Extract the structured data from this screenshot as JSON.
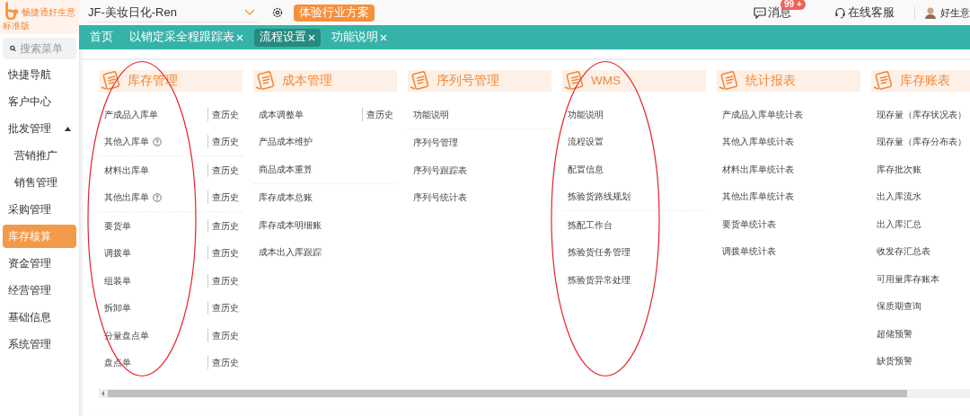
{
  "logo": {
    "brand": "畅捷通好生意",
    "edition": "标准版"
  },
  "header": {
    "account": "JF-美妆日化-Ren",
    "promo": "体验行业方案",
    "messages": {
      "label": "消息",
      "badge": "99 +"
    },
    "support": "在线客服",
    "user": "好生意"
  },
  "tabs": [
    {
      "label": "首页",
      "closable": false,
      "selected": false
    },
    {
      "label": "以销定采全程跟踪表",
      "closable": true,
      "selected": false
    },
    {
      "label": "流程设置",
      "closable": true,
      "selected": true
    },
    {
      "label": "功能说明",
      "closable": true,
      "selected": false
    }
  ],
  "sidebar": {
    "search_placeholder": "搜索菜单",
    "items": [
      {
        "label": "快捷导航",
        "selected": false
      },
      {
        "label": "客户中心",
        "selected": false
      },
      {
        "label": "批发管理",
        "selected": false,
        "expanded": true,
        "children": [
          {
            "label": "营销推广",
            "selected": false
          },
          {
            "label": "销售管理",
            "selected": false
          }
        ]
      },
      {
        "label": "采购管理",
        "selected": false
      },
      {
        "label": "库存核算",
        "selected": true
      },
      {
        "label": "资金管理",
        "selected": false
      },
      {
        "label": "经营管理",
        "selected": false
      },
      {
        "label": "基础信息",
        "selected": false
      },
      {
        "label": "系统管理",
        "selected": false
      }
    ]
  },
  "columns": [
    {
      "title": "库存管理",
      "circled": true,
      "groups": [
        [
          {
            "label": "产成品入库单",
            "help": false,
            "history": "查历史"
          },
          {
            "label": "其他入库单",
            "help": true,
            "history": "查历史"
          }
        ],
        [
          {
            "label": "材料出库单",
            "help": false,
            "history": "查历史"
          },
          {
            "label": "其他出库单",
            "help": true,
            "history": "查历史"
          }
        ],
        [
          {
            "label": "要货单",
            "help": false,
            "history": "查历史"
          },
          {
            "label": "调拨单",
            "help": false,
            "history": "查历史"
          },
          {
            "label": "组装单",
            "help": false,
            "history": "查历史"
          },
          {
            "label": "拆卸单",
            "help": false,
            "history": "查历史"
          },
          {
            "label": "分量盘点单",
            "help": false,
            "history": "查历史"
          },
          {
            "label": "盘点单",
            "help": false,
            "history": "查历史"
          }
        ]
      ]
    },
    {
      "title": "成本管理",
      "circled": false,
      "groups": [
        [
          {
            "label": "成本调整单",
            "history": "查历史"
          },
          {
            "label": "产品成本维护"
          },
          {
            "label": "商品成本重算"
          }
        ],
        [
          {
            "label": "库存成本总账"
          },
          {
            "label": "库存成本明细账"
          },
          {
            "label": "成本出入库跟踪"
          }
        ]
      ]
    },
    {
      "title": "序列号管理",
      "circled": false,
      "groups": [
        [
          {
            "label": "功能说明"
          }
        ],
        [
          {
            "label": "序列号管理"
          },
          {
            "label": "序列号跟踪表"
          },
          {
            "label": "序列号统计表"
          }
        ]
      ]
    },
    {
      "title": "WMS",
      "circled": true,
      "groups": [
        [
          {
            "label": "功能说明"
          },
          {
            "label": "流程设置"
          },
          {
            "label": "配置信息"
          },
          {
            "label": "拣验货路线规划"
          }
        ],
        [
          {
            "label": "拣配工作台"
          },
          {
            "label": "拣验货任务管理"
          },
          {
            "label": "拣验货异常处理"
          }
        ]
      ]
    },
    {
      "title": "统计报表",
      "circled": false,
      "groups": [
        [
          {
            "label": "产成品入库单统计表"
          },
          {
            "label": "其他入库单统计表"
          },
          {
            "label": "材料出库单统计表"
          },
          {
            "label": "其他出库单统计表"
          },
          {
            "label": "要货单统计表"
          },
          {
            "label": "调拨单统计表"
          }
        ]
      ]
    },
    {
      "title": "库存账表",
      "circled": false,
      "groups": [
        [
          {
            "label": "现存量（库存状况表）"
          },
          {
            "label": "现存量（库存分布表）"
          },
          {
            "label": "库存批次账"
          },
          {
            "label": "出入库流水"
          },
          {
            "label": "出入库汇总"
          },
          {
            "label": "收发存汇总表"
          },
          {
            "label": "可用量库存账本"
          },
          {
            "label": "保质期查询"
          },
          {
            "label": "超储预警"
          },
          {
            "label": "缺货预警"
          }
        ]
      ]
    }
  ]
}
